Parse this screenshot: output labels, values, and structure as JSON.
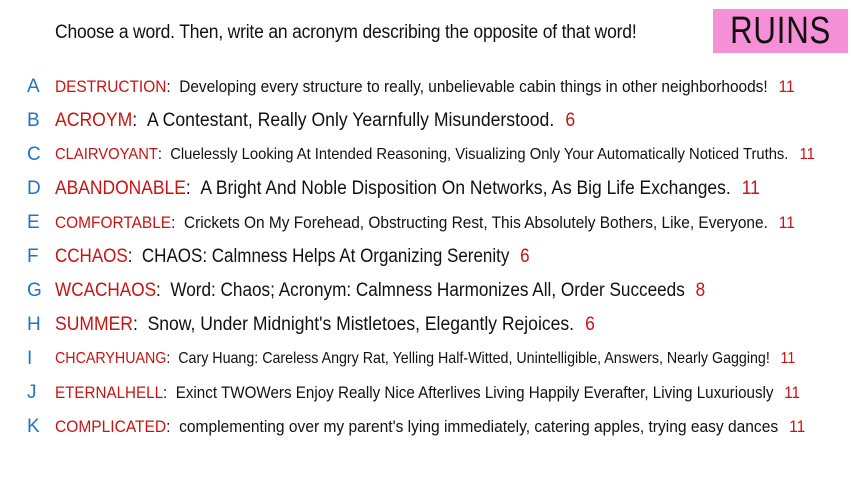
{
  "header": {
    "prompt": "Choose a word. Then, write an acronym describing the opposite of that word!",
    "badge": "RUINS"
  },
  "colors": {
    "letter": "#1e74c8",
    "word": "#cc1111",
    "count": "#cc1111",
    "badge_bg": "#f58fd6"
  },
  "entries": [
    {
      "letter": "A",
      "word": "DESTRUCTION",
      "acronym": "Developing every structure to really, unbelievable cabin things in other neighborhoods!",
      "count": "11"
    },
    {
      "letter": "B",
      "word": "ACROYM",
      "acronym": "A Contestant, Really Only Yearnfully Misunderstood.",
      "count": "6"
    },
    {
      "letter": "C",
      "word": "CLAIRVOYANT",
      "acronym": "Cluelessly Looking At Intended Reasoning, Visualizing Only Your Automatically Noticed Truths.",
      "count": "11"
    },
    {
      "letter": "D",
      "word": "ABANDONABLE",
      "acronym": "A Bright And Noble Disposition On Networks, As Big Life Exchanges.",
      "count": "11"
    },
    {
      "letter": "E",
      "word": "COMFORTABLE",
      "acronym": "Crickets On My Forehead, Obstructing Rest, This Absolutely Bothers, Like, Everyone.",
      "count": "11"
    },
    {
      "letter": "F",
      "word": "CCHAOS",
      "acronym": "CHAOS: Calmness Helps At Organizing Serenity",
      "count": "6"
    },
    {
      "letter": "G",
      "word": "WCACHAOS",
      "acronym": "Word: Chaos; Acronym: Calmness Harmonizes All, Order Succeeds",
      "count": "8"
    },
    {
      "letter": "H",
      "word": "SUMMER",
      "acronym": "Snow, Under Midnight's Mistletoes, Elegantly Rejoices.",
      "count": "6"
    },
    {
      "letter": "I",
      "word": "CHCARYHUANG",
      "acronym": "Cary Huang: Careless Angry Rat, Yelling Half-Witted, Unintelligible, Answers, Nearly Gagging!",
      "count": "11"
    },
    {
      "letter": "J",
      "word": "ETERNALHELL",
      "acronym": "Exinct TWOWers Enjoy Really Nice Afterlives Living Happily Everafter, Living Luxuriously",
      "count": "11"
    },
    {
      "letter": "K",
      "word": "COMPLICATED",
      "acronym": "complementing over my parent's lying immediately, catering apples, trying easy dances",
      "count": "11"
    }
  ]
}
